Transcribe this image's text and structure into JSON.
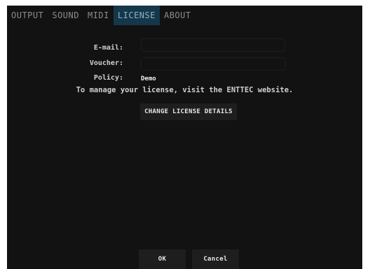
{
  "tabs": [
    {
      "label": "OUTPUT",
      "active": false
    },
    {
      "label": "SOUND",
      "active": false
    },
    {
      "label": "MIDI",
      "active": false
    },
    {
      "label": "LICENSE",
      "active": true
    },
    {
      "label": "ABOUT",
      "active": false
    }
  ],
  "license": {
    "email_label": "E-mail:",
    "email_value": "",
    "voucher_label": "Voucher:",
    "voucher_value": "",
    "policy_label": "Policy:",
    "policy_value": "Demo",
    "note": "To manage your license, visit the ENTTEC website.",
    "change_button": "CHANGE LICENSE DETAILS"
  },
  "footer": {
    "ok": "OK",
    "cancel": "Cancel"
  },
  "colors": {
    "background": "#121212",
    "active_tab_bg": "#15374a",
    "button_bg": "#1e1e1e"
  }
}
